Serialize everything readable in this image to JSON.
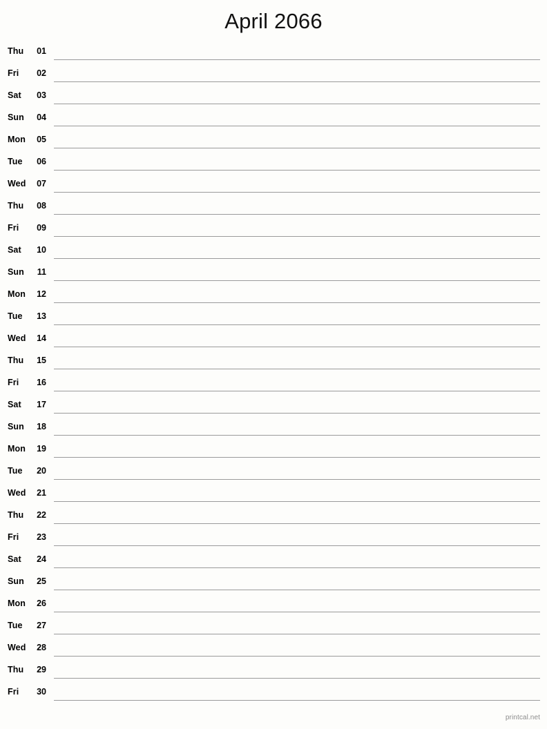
{
  "document": {
    "title": "April 2066",
    "month": "April",
    "year": "2066",
    "type": "printable-notes-calendar",
    "days_in_month": 30
  },
  "colors": {
    "background": "#fdfdfb",
    "text": "#000000",
    "title_text": "#111111",
    "rule_line": "#9a9a9a",
    "footer_text": "#8c8c8c"
  },
  "rows": [
    {
      "weekday": "Thu",
      "date": "01"
    },
    {
      "weekday": "Fri",
      "date": "02"
    },
    {
      "weekday": "Sat",
      "date": "03"
    },
    {
      "weekday": "Sun",
      "date": "04"
    },
    {
      "weekday": "Mon",
      "date": "05"
    },
    {
      "weekday": "Tue",
      "date": "06"
    },
    {
      "weekday": "Wed",
      "date": "07"
    },
    {
      "weekday": "Thu",
      "date": "08"
    },
    {
      "weekday": "Fri",
      "date": "09"
    },
    {
      "weekday": "Sat",
      "date": "10"
    },
    {
      "weekday": "Sun",
      "date": "11"
    },
    {
      "weekday": "Mon",
      "date": "12"
    },
    {
      "weekday": "Tue",
      "date": "13"
    },
    {
      "weekday": "Wed",
      "date": "14"
    },
    {
      "weekday": "Thu",
      "date": "15"
    },
    {
      "weekday": "Fri",
      "date": "16"
    },
    {
      "weekday": "Sat",
      "date": "17"
    },
    {
      "weekday": "Sun",
      "date": "18"
    },
    {
      "weekday": "Mon",
      "date": "19"
    },
    {
      "weekday": "Tue",
      "date": "20"
    },
    {
      "weekday": "Wed",
      "date": "21"
    },
    {
      "weekday": "Thu",
      "date": "22"
    },
    {
      "weekday": "Fri",
      "date": "23"
    },
    {
      "weekday": "Sat",
      "date": "24"
    },
    {
      "weekday": "Sun",
      "date": "25"
    },
    {
      "weekday": "Mon",
      "date": "26"
    },
    {
      "weekday": "Tue",
      "date": "27"
    },
    {
      "weekday": "Wed",
      "date": "28"
    },
    {
      "weekday": "Thu",
      "date": "29"
    },
    {
      "weekday": "Fri",
      "date": "30"
    }
  ],
  "footer": {
    "credit": "printcal.net"
  }
}
